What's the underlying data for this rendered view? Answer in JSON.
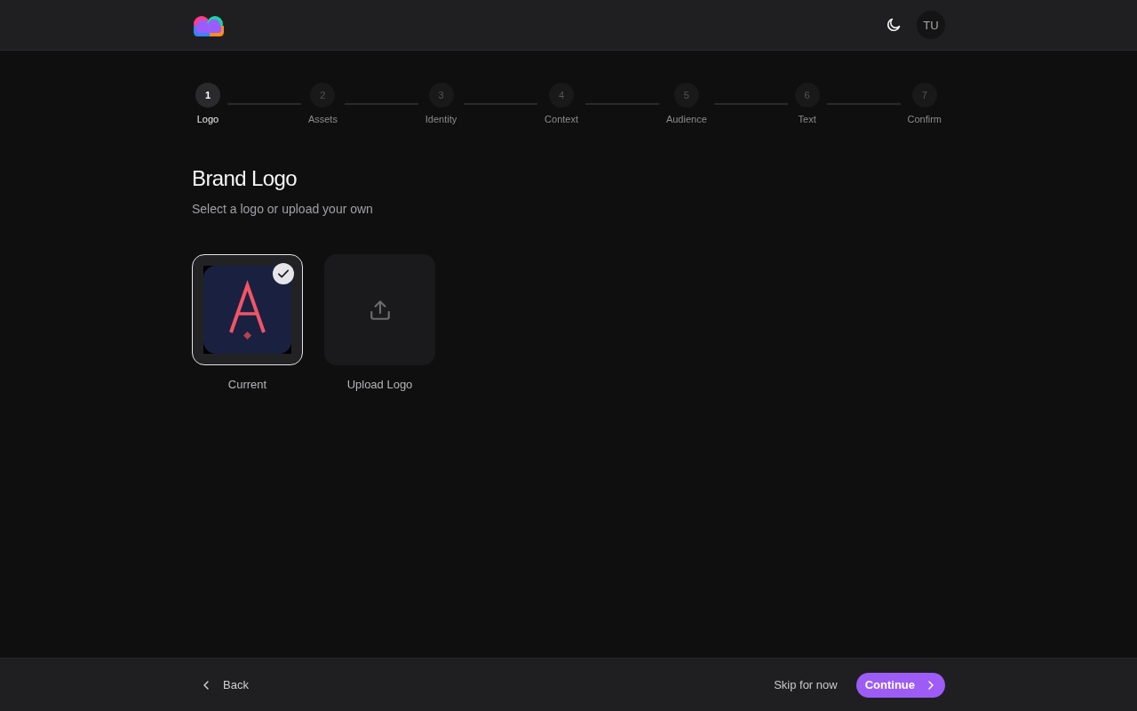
{
  "header": {
    "avatar": {
      "initials": "TU"
    }
  },
  "stepper": {
    "steps": [
      {
        "number": "1",
        "label": "Logo",
        "selected": true
      },
      {
        "number": "2",
        "label": "Assets",
        "selected": false
      },
      {
        "number": "3",
        "label": "Identity",
        "selected": false
      },
      {
        "number": "4",
        "label": "Context",
        "selected": false
      },
      {
        "number": "5",
        "label": "Audience",
        "selected": false
      },
      {
        "number": "6",
        "label": "Text",
        "selected": false
      },
      {
        "number": "7",
        "label": "Confirm",
        "selected": false
      }
    ]
  },
  "page": {
    "title": "Brand Logo",
    "subtitle": "Select a logo or upload your own"
  },
  "logo_options": [
    {
      "kind": "image",
      "label": "Current",
      "selected": true
    },
    {
      "kind": "upload",
      "label": "Upload Logo",
      "selected": false
    }
  ],
  "footer": {
    "back": "Back",
    "skip": "Skip for now",
    "continue": "Continue"
  }
}
